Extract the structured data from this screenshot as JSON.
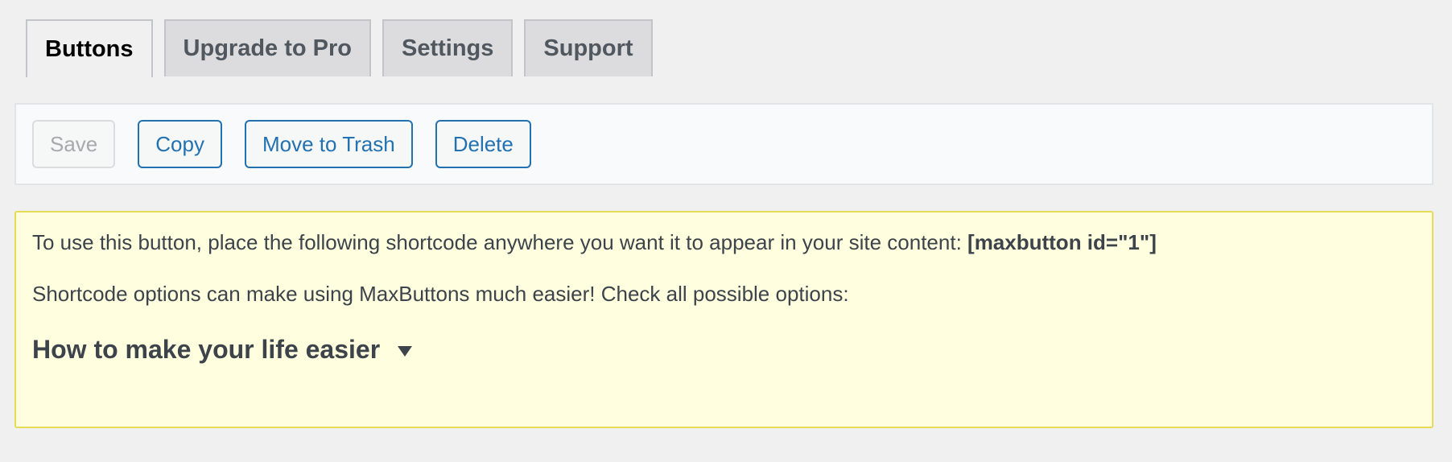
{
  "tabs": [
    {
      "label": "Buttons",
      "active": true
    },
    {
      "label": "Upgrade to Pro",
      "active": false
    },
    {
      "label": "Settings",
      "active": false
    },
    {
      "label": "Support",
      "active": false
    }
  ],
  "toolbar": {
    "save_label": "Save",
    "copy_label": "Copy",
    "trash_label": "Move to Trash",
    "delete_label": "Delete"
  },
  "notice": {
    "line1_text": "To use this button, place the following shortcode anywhere you want it to appear in your site content: ",
    "shortcode": "[maxbutton id=\"1\"]",
    "line2_text": "Shortcode options can make using MaxButtons much easier! Check all possible options:",
    "howto_title": "How to make your life easier",
    "howto_icon": "caret-down-icon"
  },
  "colors": {
    "background": "#f0f0f1",
    "link_blue": "#2271b1",
    "notice_bg": "#ffffe0",
    "notice_border": "#e6db55"
  }
}
